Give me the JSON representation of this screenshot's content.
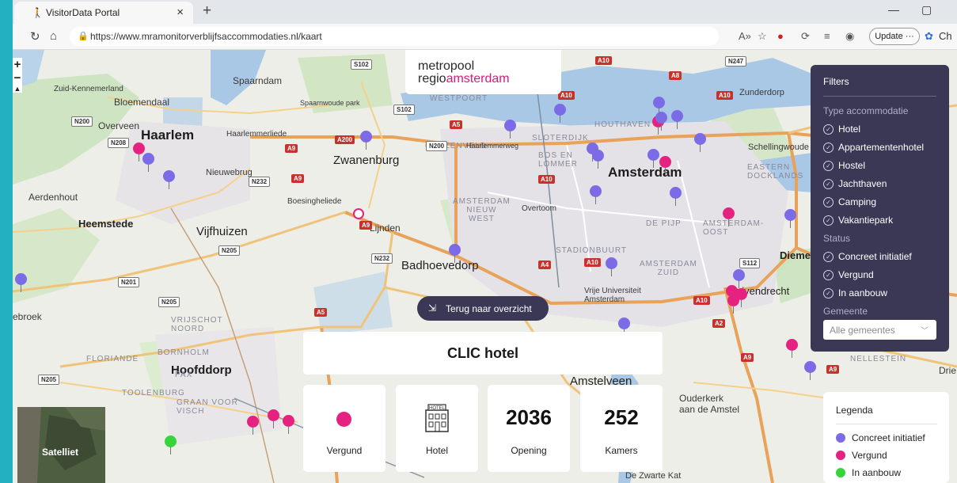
{
  "browser": {
    "tab_title": "VisitorData Portal",
    "tab_icon": "walking-person-icon",
    "url": "https://www.mramonitorverblijfsaccommodaties.nl/kaart",
    "update_label": "Update",
    "profile_label": "Ch"
  },
  "logo": {
    "line1": "metropool",
    "line2_prefix": "regio",
    "line2_brand": "amsterdam"
  },
  "colors": {
    "concreet": "#7b6be6",
    "vergund": "#e5227f",
    "in_aanbouw": "#35d43a",
    "panel": "#3b3856",
    "frame": "#23b0c0"
  },
  "filters": {
    "title": "Filters",
    "type_heading": "Type accommodatie",
    "types": [
      "Hotel",
      "Appartementenhotel",
      "Hostel",
      "Jachthaven",
      "Camping",
      "Vakantiepark"
    ],
    "status_heading": "Status",
    "statuses": [
      "Concreet initiatief",
      "Vergund",
      "In aanbouw"
    ],
    "gemeente_heading": "Gemeente",
    "gemeente_placeholder": "Alle gemeentes"
  },
  "back_button": "Terug naar overzicht",
  "hotel": {
    "name": "CLIC hotel",
    "status": "Vergund",
    "type": "Hotel",
    "opening": "2036",
    "opening_label": "Opening",
    "rooms": "252",
    "rooms_label": "Kamers"
  },
  "hotel_icon_sign": "HOTEL",
  "satellite_label": "Satelliet",
  "legend": {
    "title": "Legenda",
    "items": [
      {
        "label": "Concreet initiatief",
        "color": "#7b6be6"
      },
      {
        "label": "Vergund",
        "color": "#e5227f"
      },
      {
        "label": "In aanbouw",
        "color": "#35d43a"
      }
    ]
  },
  "map_labels": {
    "zandvoort": "Zuid-Kennemerland",
    "bloemendaal": "Bloemendaal",
    "overveen": "Overveen",
    "haarlem": "Haarlem",
    "spaarndam": "Spaarndam",
    "spaarnwoude": "Spaarnwoude park",
    "haarlemmerliede": "Haarlemmerliede",
    "zwanenburg": "Zwanenburg",
    "nieuwebrug": "Nieuwebrug",
    "aerdenhout": "Aerdenhout",
    "heemstede": "Heemstede",
    "vijfhuizen": "Vijfhuizen",
    "boesingheliede": "Boesingheliede",
    "lijnden": "Lijnden",
    "badhoevedorp": "Badhoevedorp",
    "amsterdam": "Amsterdam",
    "westpoort": "WESTPOORT",
    "houthaven": "HOUTHAVEN",
    "sloterdijk": "SLOTERDIJK",
    "bos_en_lommer": "BOS EN\nLOMMER",
    "geuzenveld": "GEUZENVELD",
    "amsterdam_west": "AMSTERDAM\nNIEUW\nWEST",
    "stadionbuurt": "STADIONBUURT",
    "amsterdam_zuid": "AMSTERDAM\nZUID",
    "de_pijp": "DE PIJP",
    "amsterdam_oost": "AMSTERDAM-\nOOST",
    "zunderdorp": "Zunderdorp",
    "schellingwoude": "Schellingwoude",
    "diemen": "Diemen",
    "duivendrecht": "uivendrecht",
    "vu": "Vrije Universiteit\nAmsterdam",
    "hoofddorp": "Hoofddorp",
    "amstelveen": "Amstelveen",
    "ouderkerk": "Ouderkerk\naan de Amstel",
    "zwarte_kat": "De Zwarte Kat",
    "nellestein": "NELLESTEIN",
    "dries": "Drie",
    "broek": "ebroek",
    "vrijschot": "VRIJSCHOT\nNOORD",
    "bornholm": "BORNHOLM",
    "floriande": "FLORIANDE",
    "pax": "PAX",
    "toolenburg": "TOOLENBURG",
    "graan": "GRAAN VOOR\nVISCH",
    "eastern": "EASTERN\nDOCKLANDS",
    "overtoom": "Overtoom",
    "haarlemmerweg": "Haarlemmerweg"
  },
  "road_labels": [
    "S102",
    "N200",
    "N208",
    "A9",
    "N232",
    "A200",
    "S102",
    "N200",
    "A10",
    "A5",
    "A8",
    "N247",
    "A10",
    "N205",
    "N201",
    "N205",
    "A4",
    "A10",
    "A10",
    "S112",
    "A2",
    "A9",
    "A10",
    "N205",
    "A9",
    "A5",
    "A9",
    "N232",
    "A10",
    "A9"
  ]
}
